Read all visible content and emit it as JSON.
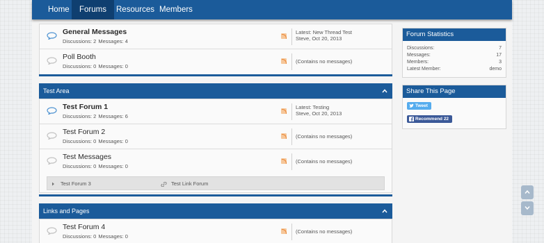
{
  "nav": {
    "items": [
      "Home",
      "Forums",
      "Resources",
      "Members"
    ]
  },
  "category_top": {
    "forums": [
      {
        "title": "General Messages",
        "discussions_label": "Discussions: 2",
        "messages_label": "Messages: 4",
        "last_line1": "Latest: New Thread Test",
        "last_line2": "Steve, Oct 20, 2013"
      },
      {
        "title": "Poll Booth",
        "discussions_label": "Discussions: 0",
        "messages_label": "Messages: 0",
        "last_line1": "(Contains no messages)"
      }
    ]
  },
  "category_test": {
    "title": "Test Area",
    "forums": [
      {
        "title": "Test Forum 1",
        "discussions_label": "Discussions: 2",
        "messages_label": "Messages: 6",
        "last_line1": "Latest: Testing",
        "last_line2": "Steve, Oct 20, 2013"
      },
      {
        "title": "Test Forum 2",
        "discussions_label": "Discussions: 0",
        "messages_label": "Messages: 0",
        "last_line1": "(Contains no messages)"
      },
      {
        "title": "Test Messages",
        "discussions_label": "Discussions: 0",
        "messages_label": "Messages: 0",
        "last_line1": "(Contains no messages)"
      }
    ],
    "subforums": [
      "Test Forum 3",
      "Test Link Forum"
    ]
  },
  "category_links": {
    "title": "Links and Pages",
    "forums": [
      {
        "title": "Test Forum 4",
        "discussions_label": "Discussions: 0",
        "messages_label": "Messages: 0",
        "last_line1": "(Contains no messages)"
      }
    ]
  },
  "sidebar": {
    "stats_title": "Forum Statistics",
    "stats": [
      {
        "label": "Discussions:",
        "value": "7"
      },
      {
        "label": "Messages:",
        "value": "17"
      },
      {
        "label": "Members:",
        "value": "3"
      },
      {
        "label": "Latest Member:",
        "value": "demo"
      }
    ],
    "share_title": "Share This Page",
    "tweet_label": "Tweet",
    "recommend_label": "Recommend 22"
  },
  "colors": {
    "nav": "#1b5b9a",
    "nav_active": "#0f3f70",
    "tweet": "#55acee",
    "facebook": "#3b5998",
    "rss": "#e9893a"
  },
  "icons": {
    "forum": "chat-bubble-icon",
    "rss": "rss-icon",
    "collapse": "chevron-up-icon",
    "scroll_up": "chevron-up-icon",
    "scroll_down": "chevron-down-icon"
  }
}
